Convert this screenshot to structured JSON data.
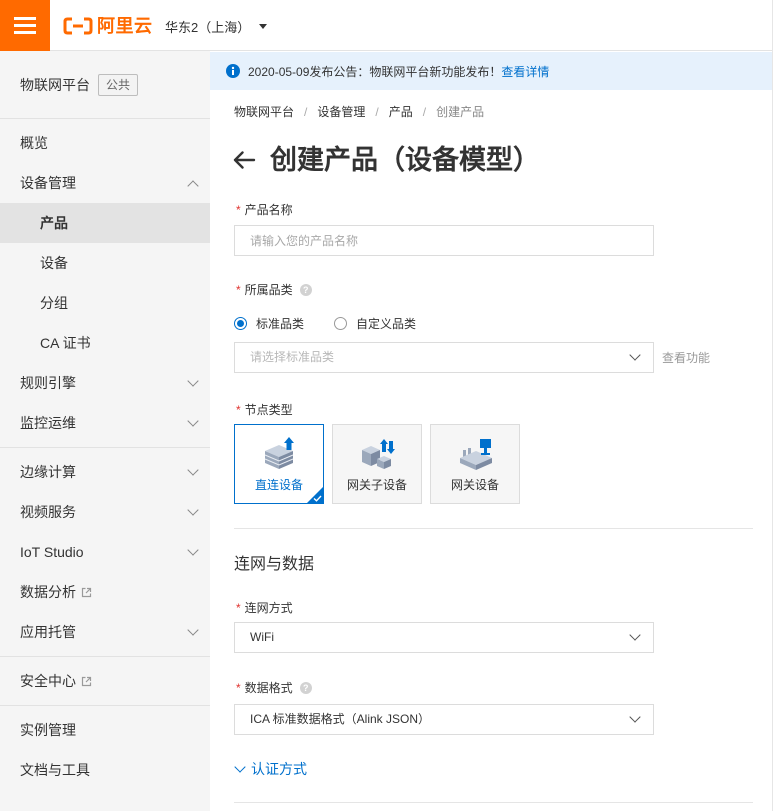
{
  "header": {
    "logo_text": "阿里云",
    "region": "华东2（上海）",
    "icons": {
      "menu": "hamburger-menu-icon",
      "logo": "aliyun-logo-icon",
      "region_dropdown": "caret-down-icon"
    }
  },
  "sidebar": {
    "product_title": "物联网平台",
    "product_badge": "公共",
    "groups": [
      {
        "items": [
          {
            "label": "概览"
          },
          {
            "label": "设备管理",
            "expanded": true,
            "children": [
              {
                "label": "产品",
                "selected": true
              },
              {
                "label": "设备"
              },
              {
                "label": "分组"
              },
              {
                "label": "CA 证书"
              }
            ]
          },
          {
            "label": "规则引擎",
            "expanded": false
          },
          {
            "label": "监控运维",
            "expanded": false
          }
        ]
      },
      {
        "items": [
          {
            "label": "边缘计算",
            "expanded": false
          },
          {
            "label": "视频服务",
            "expanded": false
          },
          {
            "label": "IoT Studio",
            "expanded": false
          },
          {
            "label": "数据分析",
            "external": true
          },
          {
            "label": "应用托管",
            "expanded": false
          }
        ]
      },
      {
        "items": [
          {
            "label": "安全中心",
            "external": true
          }
        ]
      },
      {
        "items": [
          {
            "label": "实例管理"
          },
          {
            "label": "文档与工具"
          }
        ]
      }
    ]
  },
  "notice": {
    "icon": "info-icon",
    "text": "2020-05-09发布公告：物联网平台新功能发布！",
    "link": "查看详情"
  },
  "breadcrumb": {
    "separator": "/",
    "items": [
      "物联网平台",
      "设备管理",
      "产品",
      "创建产品"
    ]
  },
  "page": {
    "back_icon": "arrow-left-icon",
    "title": "创建产品（设备模型）"
  },
  "form": {
    "required_mark": "*",
    "product_name": {
      "label": "产品名称",
      "value": "",
      "placeholder": "请输入您的产品名称"
    },
    "category": {
      "label": "所属品类",
      "help_icon": "question-icon",
      "help_glyph": "?",
      "options": [
        {
          "label": "标准品类",
          "checked": true
        },
        {
          "label": "自定义品类",
          "checked": false
        }
      ],
      "select_placeholder": "请选择标准品类",
      "view_features": "查看功能"
    },
    "node_type": {
      "label": "节点类型",
      "options": [
        {
          "label": "直连设备",
          "selected": true,
          "icon": "direct-device-icon"
        },
        {
          "label": "网关子设备",
          "selected": false,
          "icon": "gateway-sub-device-icon"
        },
        {
          "label": "网关设备",
          "selected": false,
          "icon": "gateway-device-icon"
        }
      ]
    },
    "section_title": "连网与数据",
    "network_method": {
      "label": "连网方式",
      "value": "WiFi"
    },
    "data_format": {
      "label": "数据格式",
      "value": "ICA 标准数据格式（Alink JSON）"
    },
    "auth_toggle": {
      "label": "认证方式",
      "expanded": false
    }
  },
  "colors": {
    "brand": "#ff6a00",
    "primary": "#0070cc",
    "sidebar_bg": "#f5f5f5",
    "sidebar_active_bg": "#e3e3e3",
    "notice_bg": "#e6f1fc",
    "required": "#e0332f"
  }
}
